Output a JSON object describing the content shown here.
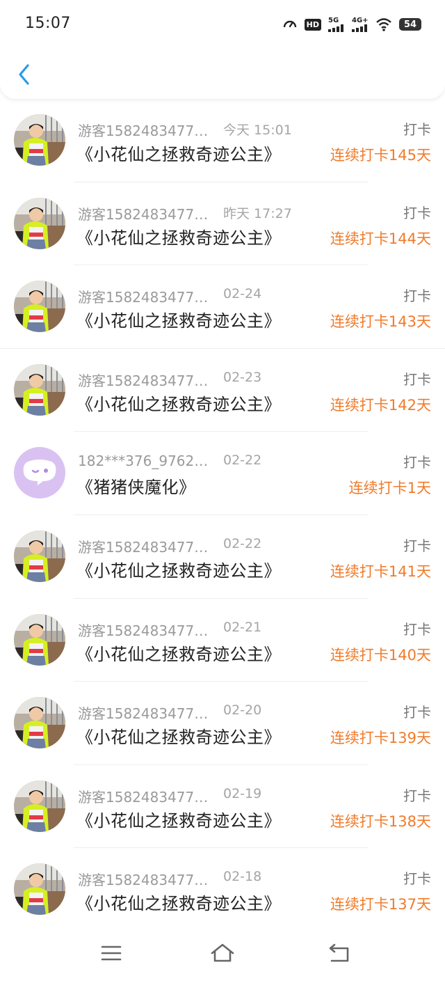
{
  "status_bar": {
    "time": "15:07",
    "icons": [
      "speedometer-icon",
      "hd-icon",
      "signal-5g-icon",
      "signal-4g-icon",
      "wifi-icon",
      "battery-icon"
    ],
    "hd_label": "HD",
    "net1_label": "5G",
    "net2_label": "4G+",
    "battery_level": "54"
  },
  "header": {
    "back_icon": "chevron-left-icon"
  },
  "colors": {
    "accent": "#f07b2a",
    "back": "#2a9be8",
    "muted": "#9a9a9a"
  },
  "records": [
    {
      "avatar": "photo",
      "user": "游客1582483477…",
      "time": "今天 15:01",
      "title": "《小花仙之拯救奇迹公主》",
      "action": "打卡",
      "streak": "连续打卡145天"
    },
    {
      "avatar": "photo",
      "user": "游客1582483477…",
      "time": "昨天 17:27",
      "title": "《小花仙之拯救奇迹公主》",
      "action": "打卡",
      "streak": "连续打卡144天"
    },
    {
      "avatar": "photo",
      "user": "游客1582483477…",
      "time": "02-24",
      "title": "《小花仙之拯救奇迹公主》",
      "action": "打卡",
      "streak": "连续打卡143天"
    },
    {
      "avatar": "photo",
      "user": "游客1582483477…",
      "time": "02-23",
      "title": "《小花仙之拯救奇迹公主》",
      "action": "打卡",
      "streak": "连续打卡142天"
    },
    {
      "avatar": "bot",
      "user": "182***376_9762…",
      "time": "02-22",
      "title": "《猪猪侠魔化》",
      "action": "打卡",
      "streak": "连续打卡1天"
    },
    {
      "avatar": "photo",
      "user": "游客1582483477…",
      "time": "02-22",
      "title": "《小花仙之拯救奇迹公主》",
      "action": "打卡",
      "streak": "连续打卡141天"
    },
    {
      "avatar": "photo",
      "user": "游客1582483477…",
      "time": "02-21",
      "title": "《小花仙之拯救奇迹公主》",
      "action": "打卡",
      "streak": "连续打卡140天"
    },
    {
      "avatar": "photo",
      "user": "游客1582483477…",
      "time": "02-20",
      "title": "《小花仙之拯救奇迹公主》",
      "action": "打卡",
      "streak": "连续打卡139天"
    },
    {
      "avatar": "photo",
      "user": "游客1582483477…",
      "time": "02-19",
      "title": "《小花仙之拯救奇迹公主》",
      "action": "打卡",
      "streak": "连续打卡138天"
    },
    {
      "avatar": "photo",
      "user": "游客1582483477…",
      "time": "02-18",
      "title": "《小花仙之拯救奇迹公主》",
      "action": "打卡",
      "streak": "连续打卡137天"
    }
  ],
  "nav_bar": {
    "menu_icon": "menu-icon",
    "home_icon": "home-icon",
    "back_icon": "back-icon"
  }
}
